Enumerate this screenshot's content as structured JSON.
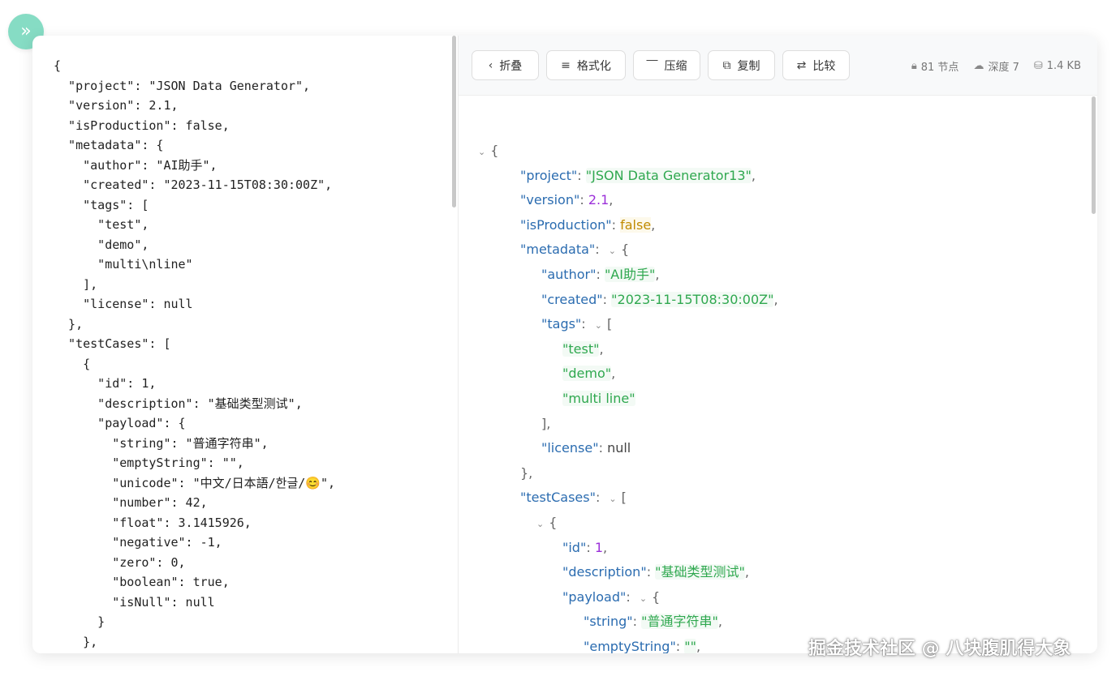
{
  "left_panel": {
    "raw_text": "{\n  \"project\": \"JSON Data Generator\",\n  \"version\": 2.1,\n  \"isProduction\": false,\n  \"metadata\": {\n    \"author\": \"AI助手\",\n    \"created\": \"2023-11-15T08:30:00Z\",\n    \"tags\": [\n      \"test\",\n      \"demo\",\n      \"multi\\nline\"\n    ],\n    \"license\": null\n  },\n  \"testCases\": [\n    {\n      \"id\": 1,\n      \"description\": \"基础类型测试\",\n      \"payload\": {\n        \"string\": \"普通字符串\",\n        \"emptyString\": \"\",\n        \"unicode\": \"中文/日本語/한글/😊\",\n        \"number\": 42,\n        \"float\": 3.1415926,\n        \"negative\": -1,\n        \"zero\": 0,\n        \"boolean\": true,\n        \"isNull\": null\n      }\n    },"
  },
  "toolbar": {
    "buttons": [
      {
        "label": "折叠",
        "icon": "chevron-left-icon"
      },
      {
        "label": "格式化",
        "icon": "format-lines-icon"
      },
      {
        "label": "压缩",
        "icon": "compress-icon"
      },
      {
        "label": "复制",
        "icon": "copy-icon"
      },
      {
        "label": "比较",
        "icon": "compare-icon"
      }
    ],
    "stats": [
      {
        "text": "81 节点",
        "icon": "lock-icon"
      },
      {
        "text": "深度 7",
        "icon": "cloud-icon"
      },
      {
        "text": "1.4 KB",
        "icon": "database-icon"
      }
    ]
  },
  "tree": {
    "lines": [
      {
        "indent": 0,
        "collapsible": true,
        "open": "{"
      },
      {
        "indent": 1,
        "key": "project",
        "value": "\"JSON Data Generator13\"",
        "vtype": "string"
      },
      {
        "indent": 1,
        "key": "version",
        "value": "2.1",
        "vtype": "number"
      },
      {
        "indent": 1,
        "key": "isProduction",
        "value": "false",
        "vtype": "boolean"
      },
      {
        "indent": 1,
        "key": "metadata",
        "collapsible": true,
        "open": "{"
      },
      {
        "indent": 2,
        "key": "author",
        "value": "\"AI助手\"",
        "vtype": "string"
      },
      {
        "indent": 2,
        "key": "created",
        "value": "\"2023-11-15T08:30:00Z\"",
        "vtype": "string"
      },
      {
        "indent": 2,
        "key": "tags",
        "collapsible": true,
        "open": "["
      },
      {
        "indent": 3,
        "value": "\"test\"",
        "vtype": "string"
      },
      {
        "indent": 3,
        "value": "\"demo\"",
        "vtype": "string"
      },
      {
        "indent": 3,
        "value": "\"multi line\"",
        "vtype": "string",
        "last": true
      },
      {
        "indent": 2,
        "close": "],"
      },
      {
        "indent": 2,
        "key": "license",
        "value": "null",
        "vtype": "null",
        "last": true
      },
      {
        "indent": 1,
        "close": "},"
      },
      {
        "indent": 1,
        "key": "testCases",
        "collapsible": true,
        "open": "["
      },
      {
        "indent": 2,
        "collapsible": true,
        "open": "{"
      },
      {
        "indent": 3,
        "key": "id",
        "value": "1",
        "vtype": "number"
      },
      {
        "indent": 3,
        "key": "description",
        "value": "\"基础类型测试\"",
        "vtype": "string"
      },
      {
        "indent": 3,
        "key": "payload",
        "collapsible": true,
        "open": "{"
      },
      {
        "indent": 4,
        "key": "string",
        "value": "\"普通字符串\"",
        "vtype": "string"
      },
      {
        "indent": 4,
        "key": "emptyString",
        "value": "\"\"",
        "vtype": "string"
      },
      {
        "indent": 4,
        "key": "unicode",
        "value": "\"中文/日本語/한글/😊\"",
        "vtype": "string"
      }
    ]
  },
  "watermark": "掘金技术社区 @ 八块腹肌得大象",
  "colors": {
    "key": "#2b6cb0",
    "string": "#2fa84f",
    "number": "#9b30d9",
    "boolean": "#c08a00",
    "accent": "#86dcc4"
  }
}
